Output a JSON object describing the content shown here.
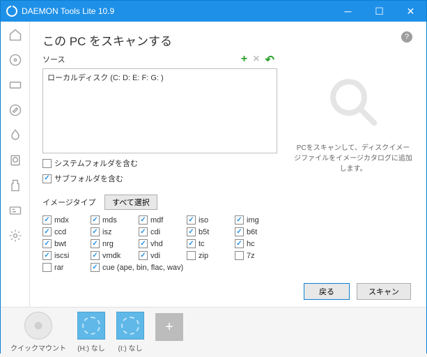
{
  "window": {
    "title": "DAEMON Tools Lite 10.9"
  },
  "page": {
    "title": "この PC をスキャンする"
  },
  "source": {
    "label": "ソース",
    "content": "ローカルディスク (C: D: E: F: G: )"
  },
  "options": {
    "include_system": {
      "label": "システムフォルダを含む",
      "checked": false
    },
    "include_sub": {
      "label": "サブフォルダを含む",
      "checked": true
    }
  },
  "types": {
    "label": "イメージタイプ",
    "select_all": "すべて選択",
    "items": [
      {
        "name": "mdx",
        "checked": true
      },
      {
        "name": "mds",
        "checked": true
      },
      {
        "name": "mdf",
        "checked": true
      },
      {
        "name": "iso",
        "checked": true
      },
      {
        "name": "img",
        "checked": true
      },
      {
        "name": "ccd",
        "checked": true
      },
      {
        "name": "isz",
        "checked": true
      },
      {
        "name": "cdi",
        "checked": true
      },
      {
        "name": "b5t",
        "checked": true
      },
      {
        "name": "b6t",
        "checked": true
      },
      {
        "name": "bwt",
        "checked": true
      },
      {
        "name": "nrg",
        "checked": true
      },
      {
        "name": "vhd",
        "checked": true
      },
      {
        "name": "tc",
        "checked": true
      },
      {
        "name": "hc",
        "checked": true
      },
      {
        "name": "iscsi",
        "checked": true
      },
      {
        "name": "vmdk",
        "checked": true
      },
      {
        "name": "vdi",
        "checked": true
      },
      {
        "name": "zip",
        "checked": false
      },
      {
        "name": "7z",
        "checked": false
      },
      {
        "name": "rar",
        "checked": false
      }
    ],
    "cue": {
      "label": "cue (ape, bin, flac, wav)",
      "checked": true
    }
  },
  "right": {
    "desc": "PCをスキャンして、ディスクイメージファイルをイメージカタログに追加します。"
  },
  "buttons": {
    "back": "戻る",
    "scan": "スキャン"
  },
  "footer": {
    "quickmount": "クイックマウント",
    "drive_h": "(H:) なし",
    "drive_i": "(I:) なし"
  }
}
